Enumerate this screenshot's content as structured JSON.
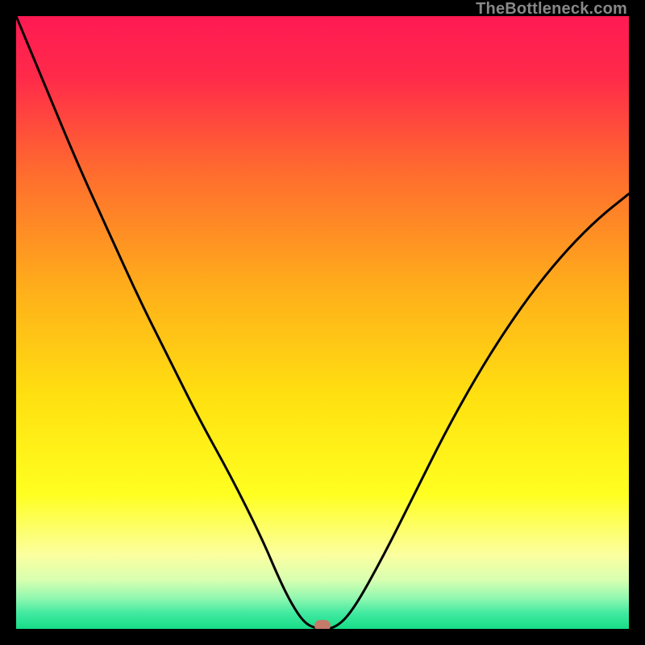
{
  "watermark": "TheBottleneck.com",
  "chart_data": {
    "type": "line",
    "title": "",
    "xlabel": "",
    "ylabel": "",
    "xlim": [
      0,
      100
    ],
    "ylim": [
      0,
      100
    ],
    "grid": false,
    "legend": false,
    "series": [
      {
        "name": "bottleneck-curve",
        "x": [
          0,
          5,
          10,
          15,
          20,
          25,
          30,
          35,
          40,
          43,
          45,
          47,
          49,
          52,
          55,
          60,
          65,
          70,
          75,
          80,
          85,
          90,
          95,
          100
        ],
        "values": [
          100,
          88,
          76,
          65,
          54,
          44,
          34,
          25,
          15,
          8,
          4,
          1,
          0,
          0,
          3,
          12,
          22,
          32,
          41,
          49,
          56,
          62,
          67,
          71
        ]
      }
    ],
    "marker": {
      "label": "optimal-point",
      "x": 50,
      "y": 0,
      "color": "#c57a6a"
    },
    "background_gradient": {
      "stops": [
        {
          "offset": 0.0,
          "color": "#ff1a53"
        },
        {
          "offset": 0.1,
          "color": "#ff2a4a"
        },
        {
          "offset": 0.25,
          "color": "#ff6a2f"
        },
        {
          "offset": 0.45,
          "color": "#ffb01a"
        },
        {
          "offset": 0.62,
          "color": "#ffe010"
        },
        {
          "offset": 0.78,
          "color": "#ffff20"
        },
        {
          "offset": 0.88,
          "color": "#fbffa0"
        },
        {
          "offset": 0.92,
          "color": "#d8ffb0"
        },
        {
          "offset": 0.95,
          "color": "#90f7b0"
        },
        {
          "offset": 0.975,
          "color": "#40e9a0"
        },
        {
          "offset": 1.0,
          "color": "#17dd88"
        }
      ]
    },
    "curve_style": {
      "stroke": "#000000",
      "width": 3
    }
  }
}
